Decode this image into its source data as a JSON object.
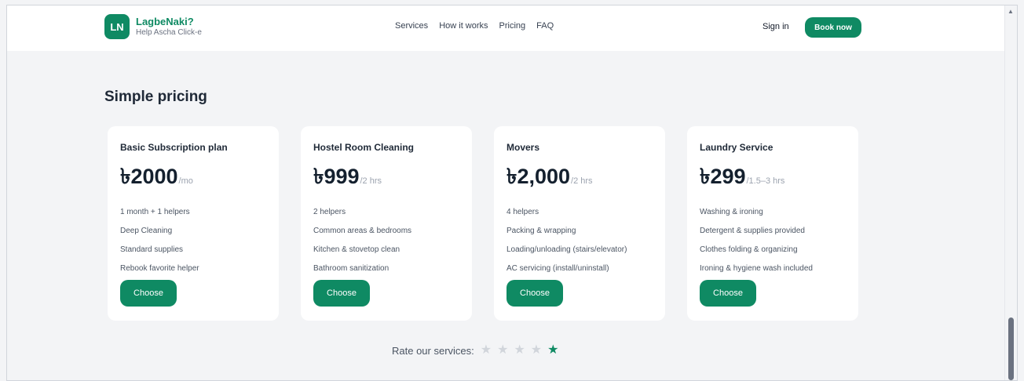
{
  "header": {
    "logo_text": "LN",
    "brand_name": "LagbeNaki?",
    "tagline": "Help Ascha Click-e",
    "nav": [
      "Services",
      "How it works",
      "Pricing",
      "FAQ"
    ],
    "sign_in": "Sign in",
    "book_now": "Book now"
  },
  "pricing": {
    "title": "Simple pricing",
    "plans": [
      {
        "name": "Basic Subscription plan",
        "price": "৳2000",
        "period": "/mo",
        "features": [
          "1 month + 1 helpers",
          "Deep Cleaning",
          "Standard supplies",
          "Rebook favorite helper"
        ],
        "button": "Choose"
      },
      {
        "name": "Hostel Room Cleaning",
        "price": "৳999",
        "period": "/2 hrs",
        "features": [
          "2 helpers",
          "Common areas & bedrooms",
          "Kitchen & stovetop clean",
          "Bathroom sanitization"
        ],
        "button": "Choose"
      },
      {
        "name": "Movers",
        "price": "৳2,000",
        "period": "/2 hrs",
        "features": [
          "4 helpers",
          "Packing & wrapping",
          "Loading/unloading (stairs/elevator)",
          "AC servicing (install/uninstall)"
        ],
        "button": "Choose"
      },
      {
        "name": "Laundry Service",
        "price": "৳299",
        "period": "/1.5–3 hrs",
        "features": [
          "Washing & ironing",
          "Detergent & supplies provided",
          "Clothes folding & organizing",
          "Ironing & hygiene wash included"
        ],
        "button": "Choose"
      }
    ]
  },
  "rating": {
    "label": "Rate our services:",
    "stars_total": 5,
    "selected": 5,
    "star_glyph": "★"
  },
  "colors": {
    "accent": "#0f8a63",
    "background": "#f3f4f6",
    "card": "#ffffff"
  }
}
